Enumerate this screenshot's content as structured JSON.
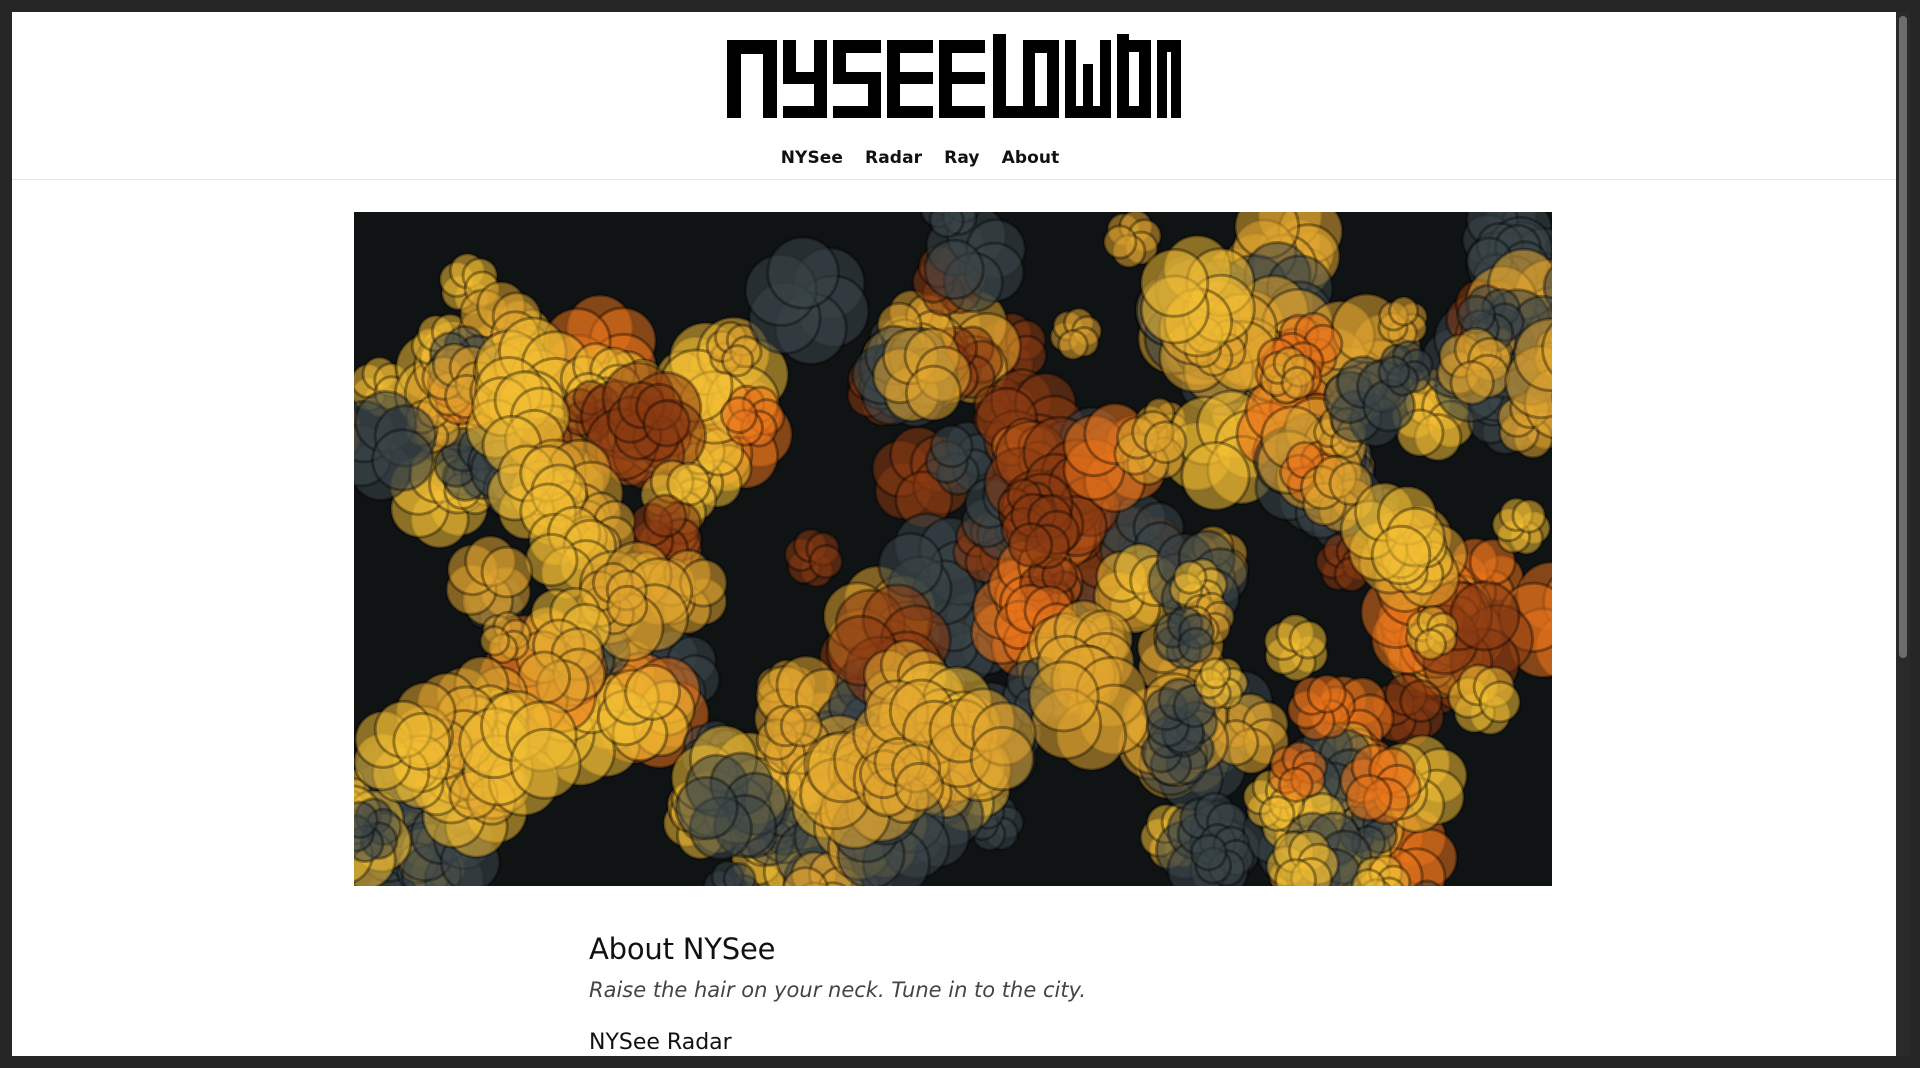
{
  "site": {
    "logo_text": "NYSEE LOWDOWN"
  },
  "nav": {
    "items": [
      {
        "label": "NYSee"
      },
      {
        "label": "Radar"
      },
      {
        "label": "Ray"
      },
      {
        "label": "About"
      }
    ]
  },
  "hero": {
    "image_subject": "orange-yellow-and-dark-slate-flower-circle-pattern",
    "colors": {
      "background": "#101314",
      "slate": "#3b4548",
      "gold": "#e2a630",
      "yellow": "#f3bd33",
      "orange": "#e8731c",
      "rust": "#8a3a12"
    }
  },
  "content": {
    "title": "About NYSee",
    "tagline": "Raise the hair on your neck. Tune in to the city.",
    "section_heading": "NYSee Radar"
  }
}
